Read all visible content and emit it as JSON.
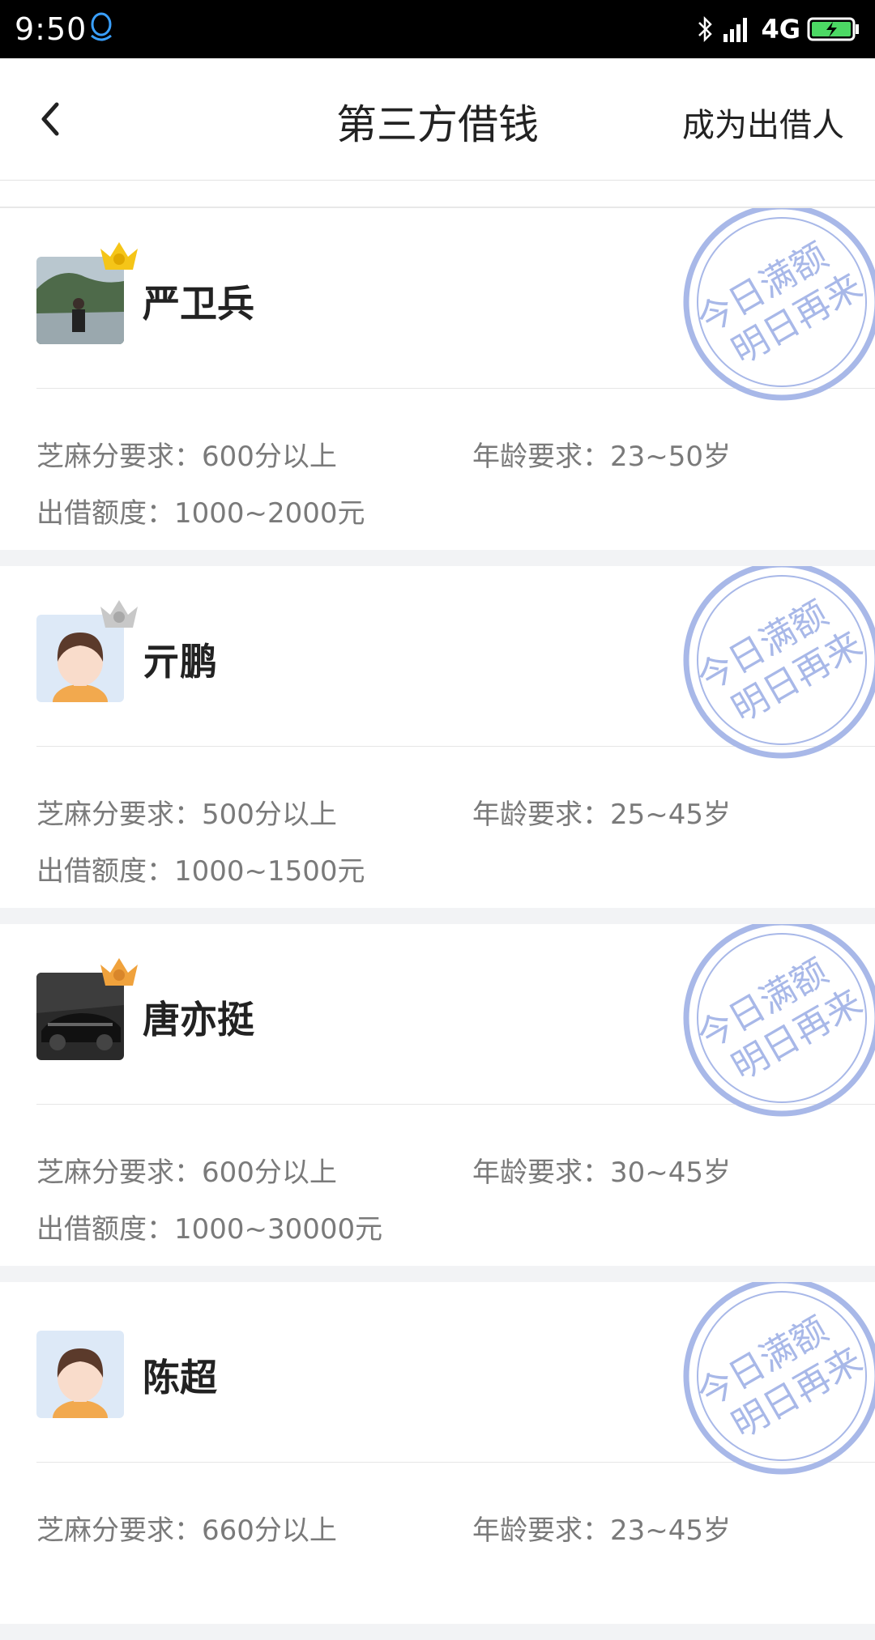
{
  "status_bar": {
    "time": "9:50",
    "network": "4G",
    "icons": [
      "qq-icon",
      "bluetooth-icon",
      "signal-icon",
      "battery-icon"
    ]
  },
  "nav": {
    "title": "第三方借钱",
    "action": "成为出借人",
    "back_icon": "back-arrow-icon"
  },
  "stamp": {
    "line1": "今日满额",
    "line2": "明日再来",
    "color": "#a8b8e8"
  },
  "lenders": [
    {
      "name": "严卫兵",
      "avatar": "photo-lake",
      "rank": 1,
      "crown_color": "#f5c518",
      "score_req_label": "芝麻分要求：",
      "score_req": "600分以上",
      "age_req_label": "年龄要求：",
      "age_req": "23~50岁",
      "amount_label": "出借额度：",
      "amount": "1000~2000元"
    },
    {
      "name": "亓鹏",
      "avatar": "default-avatar",
      "rank": 2,
      "crown_color": "#c8c8c8",
      "score_req_label": "芝麻分要求：",
      "score_req": "500分以上",
      "age_req_label": "年龄要求：",
      "age_req": "25~45岁",
      "amount_label": "出借额度：",
      "amount": "1000~1500元"
    },
    {
      "name": "唐亦挺",
      "avatar": "photo-car",
      "rank": 3,
      "crown_color": "#f0a23c",
      "score_req_label": "芝麻分要求：",
      "score_req": "600分以上",
      "age_req_label": "年龄要求：",
      "age_req": "30~45岁",
      "amount_label": "出借额度：",
      "amount": "1000~30000元"
    },
    {
      "name": "陈超",
      "avatar": "default-avatar",
      "rank": null,
      "crown_color": "",
      "score_req_label": "芝麻分要求：",
      "score_req": "660分以上",
      "age_req_label": "年龄要求：",
      "age_req": "23~45岁",
      "amount_label": "",
      "amount": ""
    }
  ]
}
